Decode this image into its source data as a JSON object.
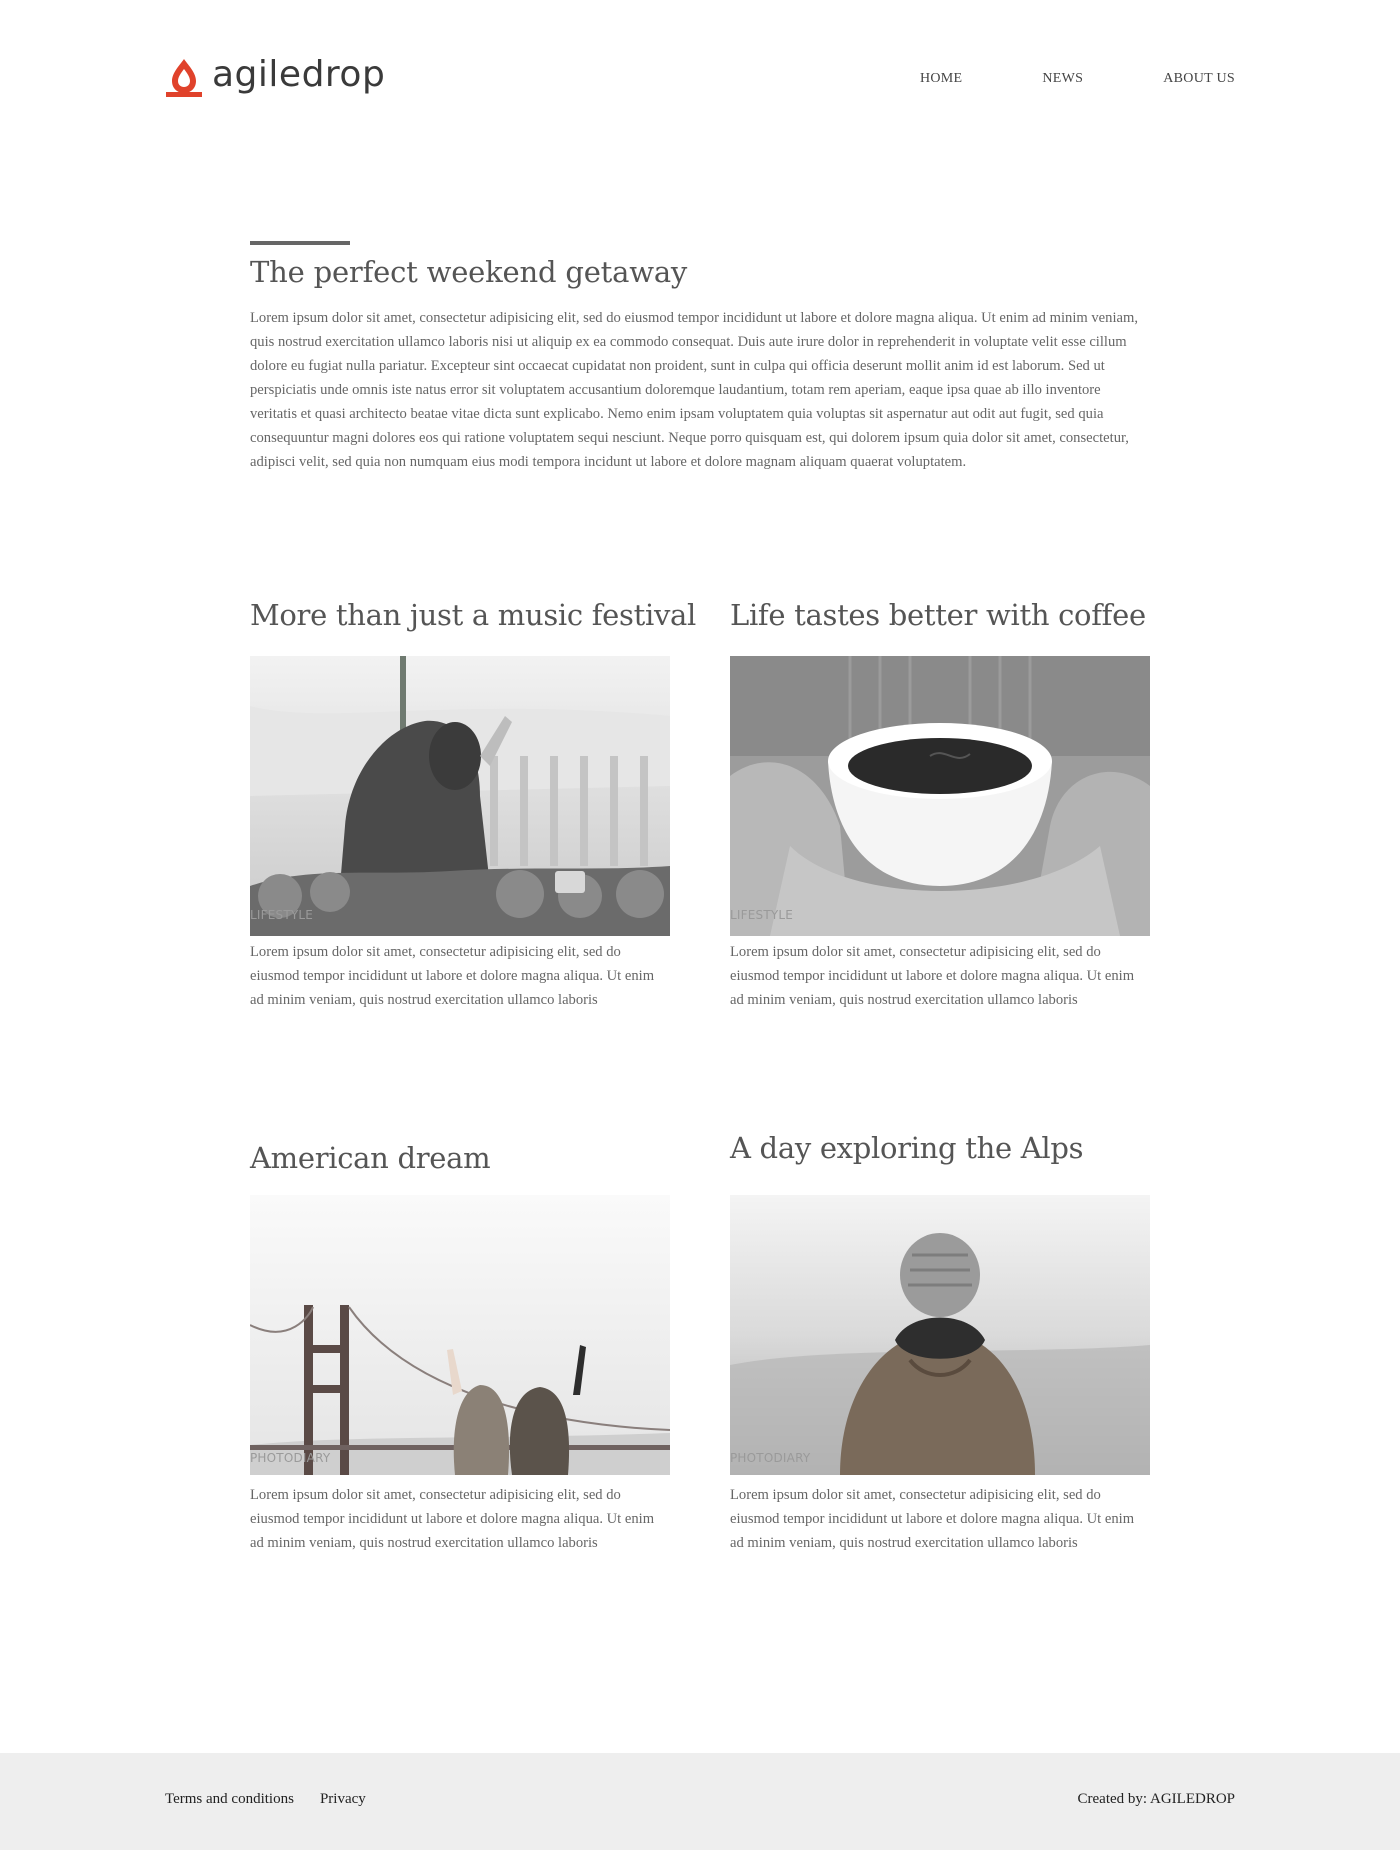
{
  "header": {
    "brand": "agiledrop",
    "brand_color": "#e0422b",
    "logo_icon": "drop-icon",
    "nav": [
      {
        "label": "HOME"
      },
      {
        "label": "NEWS"
      },
      {
        "label": "ABOUT US"
      }
    ]
  },
  "intro": {
    "title": "The perfect weekend getaway",
    "body": "Lorem ipsum dolor sit amet, consectetur adipisicing elit, sed do eiusmod tempor incididunt ut labore et dolore magna aliqua. Ut enim ad minim veniam, quis nostrud exercitation ullamco laboris nisi ut aliquip ex ea commodo consequat. Duis aute irure dolor in reprehenderit in voluptate velit esse cillum dolore eu fugiat nulla pariatur. Excepteur sint occaecat cupidatat non proident, sunt in culpa qui officia deserunt mollit anim id est laborum. Sed ut perspiciatis unde omnis iste natus error sit voluptatem accusantium doloremque laudantium, totam rem aperiam, eaque ipsa quae ab illo inventore veritatis et quasi architecto beatae vitae dicta sunt explicabo. Nemo enim ipsam voluptatem quia voluptas sit aspernatur aut odit aut fugit, sed quia consequuntur magni dolores eos qui ratione voluptatem sequi nesciunt. Neque porro quisquam est, qui dolorem ipsum quia dolor sit amet, consectetur, adipisci velit, sed quia non numquam eius modi tempora incidunt ut labore et dolore magnam aliquam quaerat voluptatem."
  },
  "articles": [
    {
      "title": "More than just a music festival",
      "category": "LIFESTYLE",
      "excerpt": "Lorem ipsum dolor sit amet, consectetur adipisicing elit, sed do eiusmod tempor incididunt ut labore et dolore magna aliqua. Ut enim ad minim veniam, quis nostrud exercitation ullamco laboris"
    },
    {
      "title": "Life tastes better with coffee",
      "category": "LIFESTYLE",
      "excerpt": "Lorem ipsum dolor sit amet, consectetur adipisicing elit, sed do eiusmod tempor incididunt ut labore et dolore magna aliqua. Ut enim ad minim veniam, quis nostrud exercitation ullamco laboris"
    },
    {
      "title": "American dream",
      "category": "PHOTODIARY",
      "excerpt": "Lorem ipsum dolor sit amet, consectetur adipisicing elit, sed do eiusmod tempor incididunt ut labore et dolore magna aliqua. Ut enim ad minim veniam, quis nostrud exercitation ullamco laboris"
    },
    {
      "title": "A day exploring the Alps",
      "category": "PHOTODIARY",
      "excerpt": "Lorem ipsum dolor sit amet, consectetur adipisicing elit, sed do eiusmod tempor incididunt ut labore et dolore magna aliqua. Ut enim ad minim veniam, quis nostrud exercitation ullamco laboris"
    }
  ],
  "footer": {
    "links": [
      {
        "label": "Terms and conditions"
      },
      {
        "label": "Privacy"
      }
    ],
    "credit": "Created by: AGILEDROP",
    "background": "#eeeeee"
  }
}
